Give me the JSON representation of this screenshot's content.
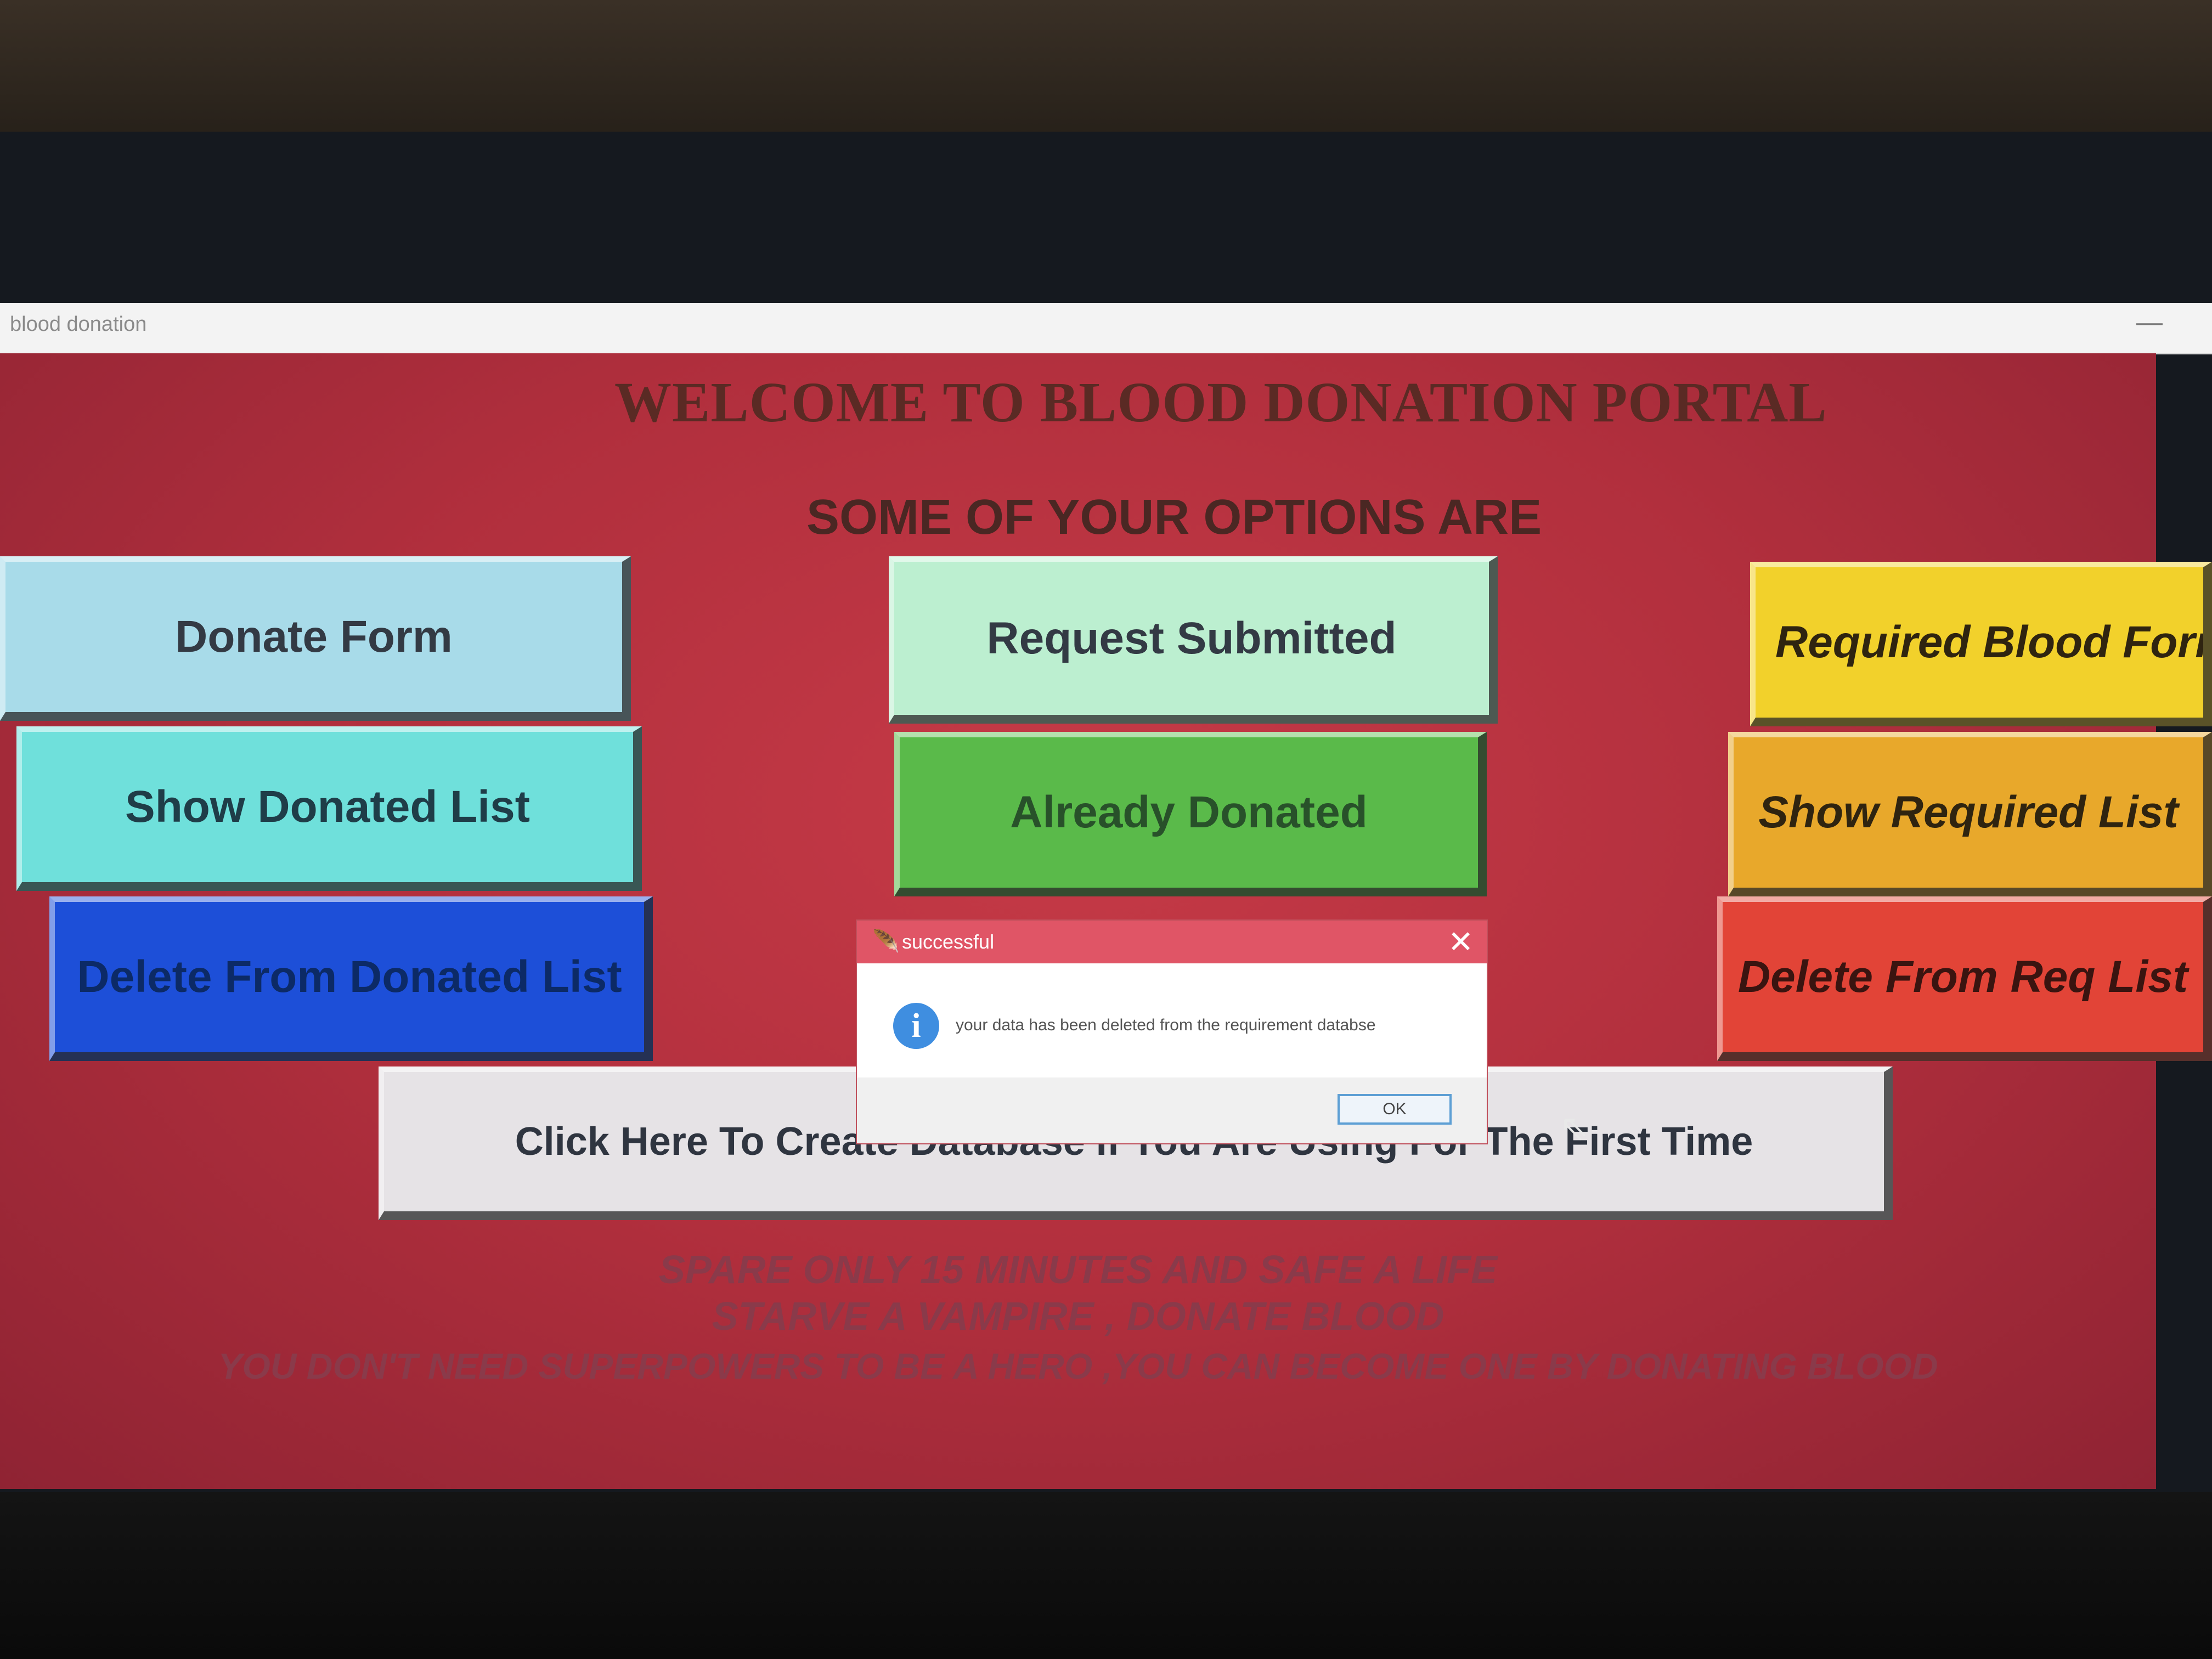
{
  "window": {
    "title": "blood donation",
    "minimize": "—"
  },
  "header": {
    "title": "WELCOME TO BLOOD DONATION PORTAL",
    "subtitle": "SOME OF YOUR OPTIONS ARE"
  },
  "buttons": {
    "donate_form": "Donate Form",
    "show_donated_list": "Show Donated List",
    "delete_from_donated_list": "Delete From Donated List",
    "request_submitted": "Request Submitted",
    "already_donated": "Already Donated",
    "required_blood_form": "Required Blood Forr",
    "show_required_list": "Show Required List",
    "delete_from_req_list": "Delete From Req List",
    "create_database": "Click Here To Create Database If You Are Using For The First Time"
  },
  "mottos": [
    "SPARE ONLY 15 MINUTES AND SAFE A LIFE",
    "STARVE A VAMPIRE , DONATE BLOOD",
    "YOU DON'T NEED SUPERPOWERS TO BE A HERO ,YOU CAN BECOME ONE BY DONATING BLOOD"
  ],
  "dialog": {
    "title": "successful",
    "message": "your data has been deleted from the requirement databse",
    "ok_label": "OK",
    "close_glyph": "✕",
    "info_glyph": "i"
  },
  "colors": {
    "window_bg": "#b12f3d",
    "dialog_title_bg": "#e05566"
  }
}
